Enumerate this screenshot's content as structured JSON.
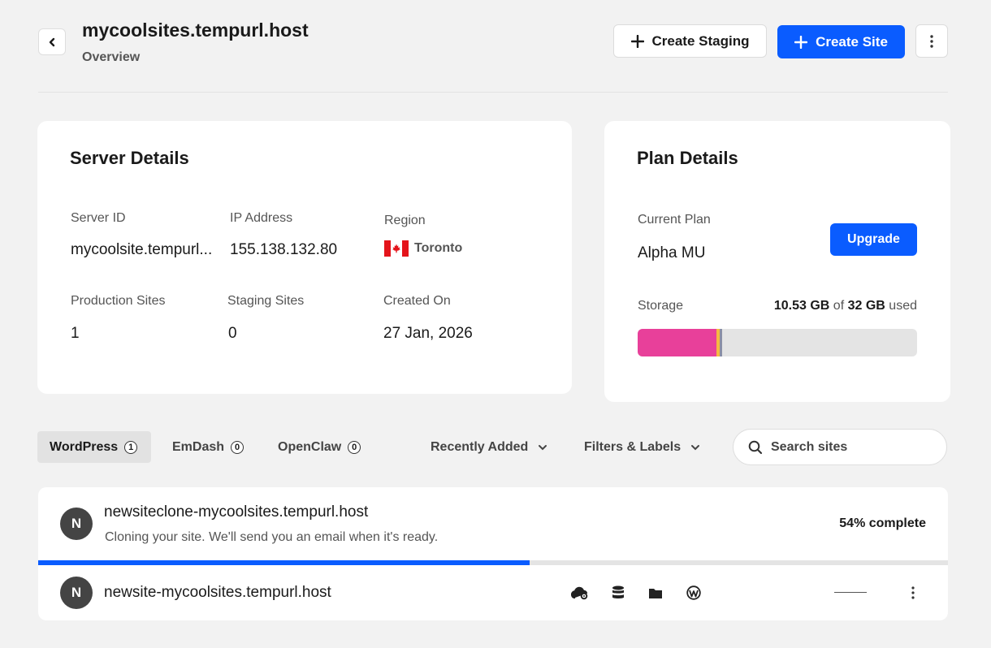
{
  "header": {
    "title": "mycoolsites.tempurl.host",
    "subtitle": "Overview",
    "create_staging_label": "Create Staging",
    "create_site_label": "Create Site"
  },
  "server_details": {
    "title": "Server Details",
    "server_id_label": "Server ID",
    "server_id_value": "mycoolsite.tempurl...",
    "ip_label": "IP Address",
    "ip_value": "155.138.132.80",
    "region_label": "Region",
    "region_value": "Toronto",
    "production_label": "Production Sites",
    "production_value": "1",
    "staging_label": "Staging Sites",
    "staging_value": "0",
    "created_label": "Created On",
    "created_value": "27 Jan, 2026"
  },
  "plan_details": {
    "title": "Plan Details",
    "current_plan_label": "Current Plan",
    "current_plan_value": "Alpha MU",
    "upgrade_label": "Upgrade",
    "storage_label": "Storage",
    "storage_used": "10.53 GB",
    "storage_of": "of",
    "storage_total": "32 GB",
    "storage_suffix": "used",
    "storage_fraction": 0.33,
    "colors": {
      "primary": "#e8409a",
      "secondary": "#f5b942",
      "tertiary": "#8a8fa5"
    }
  },
  "tabs": [
    {
      "label": "WordPress",
      "count": "1"
    },
    {
      "label": "EmDash",
      "count": "0"
    },
    {
      "label": "OpenClaw",
      "count": "0"
    }
  ],
  "sort_label": "Recently Added",
  "filters_label": "Filters & Labels",
  "search": {
    "placeholder": "Search sites"
  },
  "sites": [
    {
      "initial": "N",
      "name": "newsiteclone-mycoolsites.tempurl.host",
      "status": "Cloning your site. We'll send you an email when it's ready.",
      "progress_label": "54% complete",
      "progress": 0.54
    },
    {
      "initial": "N",
      "name": "newsite-mycoolsites.tempurl.host",
      "icons": [
        "cloud-gear-icon",
        "database-icon",
        "folder-icon",
        "wordpress-icon"
      ]
    }
  ],
  "accent_color": "#0a5cff"
}
